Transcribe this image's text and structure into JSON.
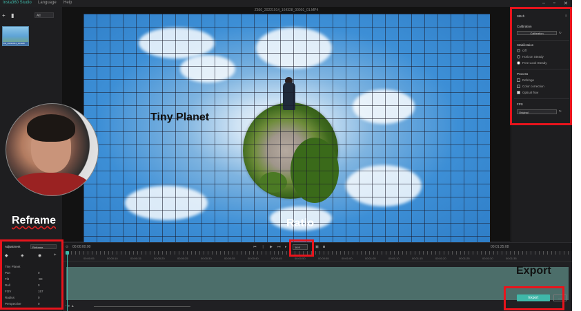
{
  "menu": {
    "app_name": "Insta360 Studio",
    "language": "Language",
    "help": "Help"
  },
  "media": {
    "add_icon": "plus-icon",
    "delete_icon": "trash-icon",
    "filter_value": "All",
    "clip_name": "VID_20221014_164328"
  },
  "video": {
    "file_title": "Z360_20221014_164328_00001_01.MP4"
  },
  "annotations": {
    "tiny_planet": "Tiny Planet",
    "reframe": "Reframe",
    "ratio": "Ratio",
    "export": "Export"
  },
  "stitch": {
    "title": "Stitch",
    "calibration_label": "Calibration",
    "calibration_button": "Calibration",
    "stabilization_label": "Stabilization",
    "stab_options": [
      "Off",
      "Horizon Steady",
      "Free Look Steady"
    ],
    "process_label": "Process",
    "process_options": [
      "Defringe",
      "Color correction",
      "Optical flow"
    ],
    "fps_label": "FPS",
    "fps_value": "Original"
  },
  "transport": {
    "time_current": "00:00:00:00",
    "ratio_value": "16:9",
    "time_total": "00:01:25:08"
  },
  "adjustment": {
    "label": "Adjustment",
    "mode": "Reframe",
    "section": "Tiny Planet",
    "params": [
      {
        "name": "Pan",
        "value": "0"
      },
      {
        "name": "Tilt",
        "value": "-90"
      },
      {
        "name": "Roll",
        "value": "0"
      },
      {
        "name": "FOV",
        "value": "157"
      },
      {
        "name": "Radius",
        "value": "0"
      },
      {
        "name": "Perspective",
        "value": "0"
      }
    ]
  },
  "ruler": [
    "00:00:05",
    "00:00:10",
    "00:00:15",
    "00:00:20",
    "00:00:25",
    "00:00:30",
    "00:00:35",
    "00:00:40",
    "00:00:45",
    "00:00:50",
    "00:00:55",
    "00:01:00",
    "00:01:05",
    "00:01:10",
    "00:01:15",
    "00:01:20",
    "00:01:25",
    "00:01:30",
    "00:01:35"
  ],
  "export": {
    "button": "Export",
    "more": "…"
  }
}
